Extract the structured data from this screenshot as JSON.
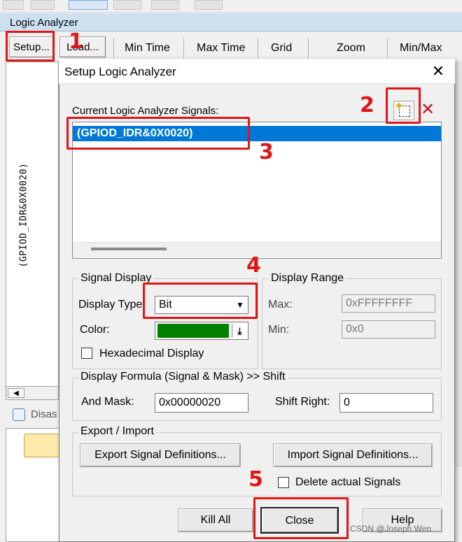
{
  "background_app": {
    "title": "Logic Analyzer",
    "buttons": {
      "setup": "Setup...",
      "load": "Load..."
    },
    "columns": {
      "min_time": "Min Time",
      "max_time": "Max Time",
      "grid": "Grid",
      "zoom": "Zoom",
      "min_max": "Min/Max"
    },
    "signal_name": "(GPIOD_IDR&0X0020)",
    "disasm_tab": "Disas"
  },
  "dialog": {
    "title": "Setup Logic Analyzer",
    "close_glyph": "✕",
    "signals_label": "Current Logic Analyzer Signals:",
    "signals": [
      "(GPIOD_IDR&0X0020)"
    ],
    "delete_glyph": "✕",
    "signal_display": {
      "legend": "Signal Display",
      "display_type_label": "Display Type",
      "display_type_value": "Bit",
      "color_label": "Color:",
      "color_value": "#008000",
      "hex_label": "Hexadecimal Display"
    },
    "display_range": {
      "legend": "Display Range",
      "max_label": "Max:",
      "max_value": "0xFFFFFFFF",
      "min_label": "Min:",
      "min_value": "0x0"
    },
    "formula": {
      "legend": "Display Formula (Signal & Mask) >> Shift",
      "and_mask_label": "And Mask:",
      "and_mask_value": "0x00000020",
      "shift_label": "Shift Right:",
      "shift_value": "0"
    },
    "export_import": {
      "legend": "Export / Import",
      "export_label": "Export Signal Definitions...",
      "import_label": "Import Signal Definitions...",
      "delete_label": "Delete actual Signals"
    },
    "buttons": {
      "kill_all": "Kill All",
      "close": "Close",
      "help": "Help"
    }
  },
  "annotations": {
    "step1": "1",
    "step2": "2",
    "step3": "3",
    "step4": "4",
    "step5": "5"
  },
  "watermark": "CSDN @Joseph Wen",
  "colors": {
    "annotation_red": "#e01616",
    "selection_blue": "#0078d7",
    "signal_green": "#008000"
  }
}
